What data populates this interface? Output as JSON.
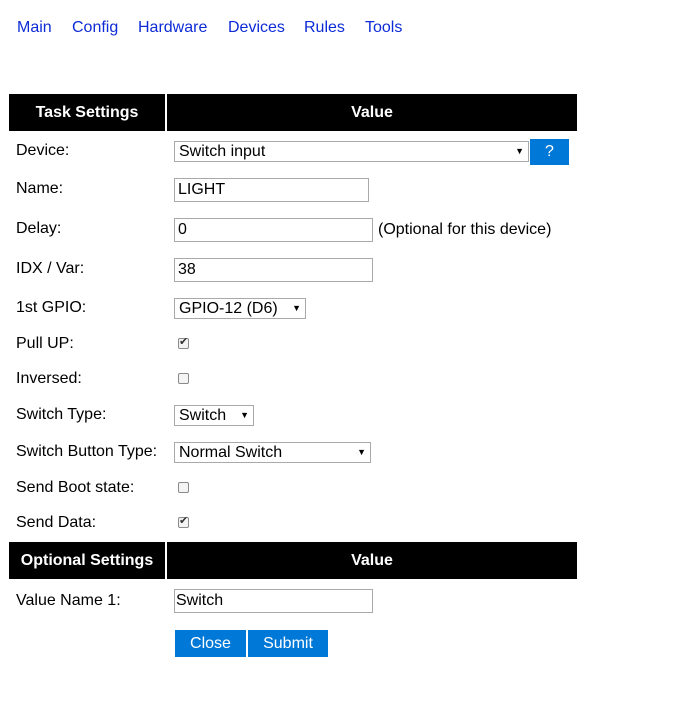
{
  "nav": [
    "Main",
    "Config",
    "Hardware",
    "Devices",
    "Rules",
    "Tools"
  ],
  "task_table": {
    "header_left": "Task Settings",
    "header_right": "Value"
  },
  "device": {
    "label": "Device:",
    "value": "Switch input",
    "help_label": "?"
  },
  "name": {
    "label": "Name:",
    "value": "LIGHT"
  },
  "delay": {
    "label": "Delay:",
    "value": "0",
    "note": "(Optional for this device)"
  },
  "idx": {
    "label": "IDX / Var:",
    "value": "38"
  },
  "gpio": {
    "label": "1st GPIO:",
    "value": "GPIO-12 (D6)"
  },
  "pullup": {
    "label": "Pull UP:",
    "checked": true
  },
  "inversed": {
    "label": "Inversed:",
    "checked": false
  },
  "switch_type": {
    "label": "Switch Type:",
    "value": "Switch"
  },
  "switch_button_type": {
    "label": "Switch Button Type:",
    "value": "Normal Switch"
  },
  "send_boot": {
    "label": "Send Boot state:",
    "checked": false
  },
  "send_data": {
    "label": "Send Data:",
    "checked": true
  },
  "optional_table": {
    "header_left": "Optional Settings",
    "header_right": "Value"
  },
  "value_name_1": {
    "label": "Value Name 1:",
    "value": "Switch"
  },
  "buttons": {
    "close": "Close",
    "submit": "Submit"
  },
  "colors": {
    "link": "#0d2bd6",
    "button": "#0078d7",
    "header_bg": "#000000"
  }
}
